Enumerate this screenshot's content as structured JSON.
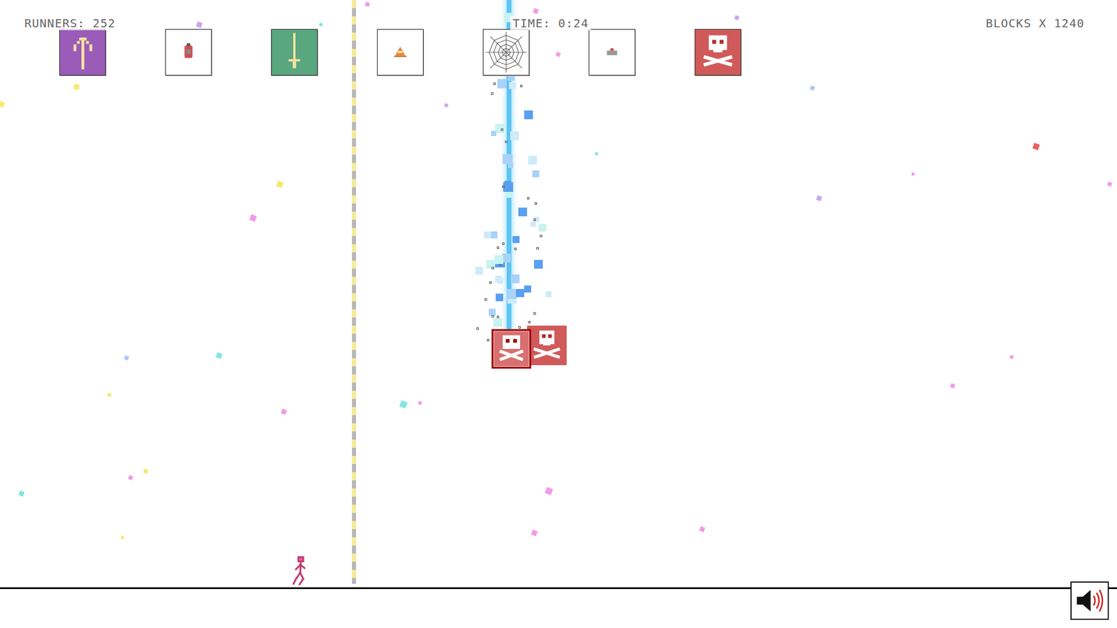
{
  "hud": {
    "runners": "RUNNERS: 252",
    "time": "TIME: 0:24",
    "blocks": "BLOCKS X 1240"
  },
  "tools": [
    {
      "kind": "jump"
    },
    {
      "kind": "bomb"
    },
    {
      "kind": "sword"
    },
    {
      "kind": "cone"
    },
    {
      "kind": "web"
    },
    {
      "kind": "plate"
    },
    {
      "kind": "skull"
    }
  ],
  "sound": {
    "on": true
  }
}
